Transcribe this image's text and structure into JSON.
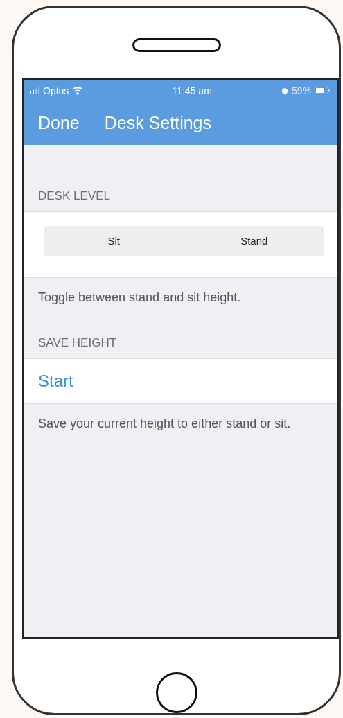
{
  "status_bar": {
    "carrier": "Optus",
    "time": "11:45 am",
    "battery": "59%"
  },
  "nav_bar": {
    "back": "Done",
    "title": "Desk Settings"
  },
  "sections": [
    {
      "kind": "segmented",
      "header": "DESK LEVEL",
      "segments": [
        {
          "label": "Sit",
          "selected": false
        },
        {
          "label": "Stand",
          "selected": false
        }
      ],
      "footer": "Toggle between stand and sit height."
    },
    {
      "kind": "action",
      "header": "SAVE HEIGHT",
      "action": "Start",
      "footer": "Save your current height to either stand or sit."
    }
  ]
}
